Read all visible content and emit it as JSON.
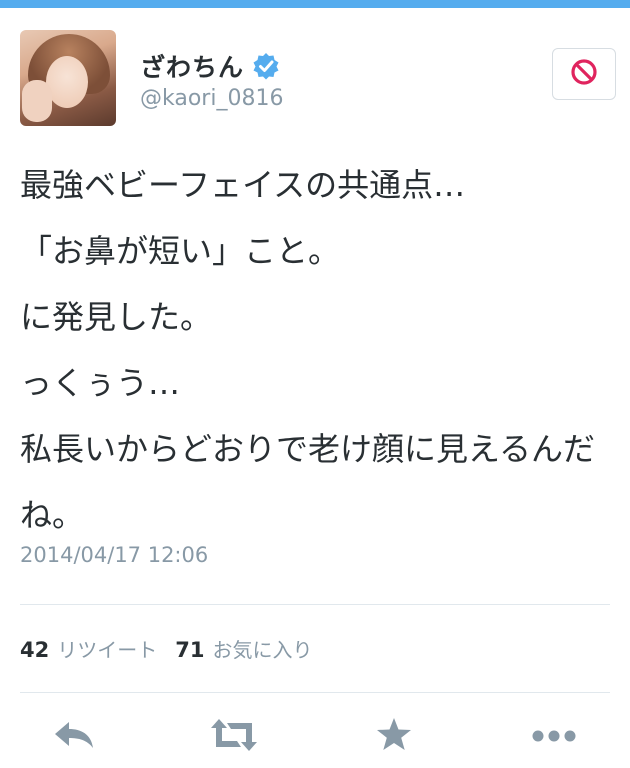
{
  "user": {
    "display_name": "ざわちん",
    "handle": "@kaori_0816"
  },
  "tweet": {
    "lines": [
      "最強ベビーフェイスの共通点…",
      "「お鼻が短い」こと。",
      "に発見した。",
      "っくぅう…",
      "私長いからどおりで老け顔に見えるんだね。"
    ],
    "timestamp": "2014/04/17 12:06"
  },
  "stats": {
    "retweets": "42",
    "retweets_label": "リツイート",
    "favorites": "71",
    "favorites_label": "お気に入り"
  },
  "colors": {
    "accent": "#55acee",
    "icon_gray": "#8899a6",
    "block_red": "#e0245e"
  },
  "icons": [
    "verified-icon",
    "block-icon",
    "reply-icon",
    "retweet-icon",
    "favorite-icon",
    "more-icon"
  ]
}
